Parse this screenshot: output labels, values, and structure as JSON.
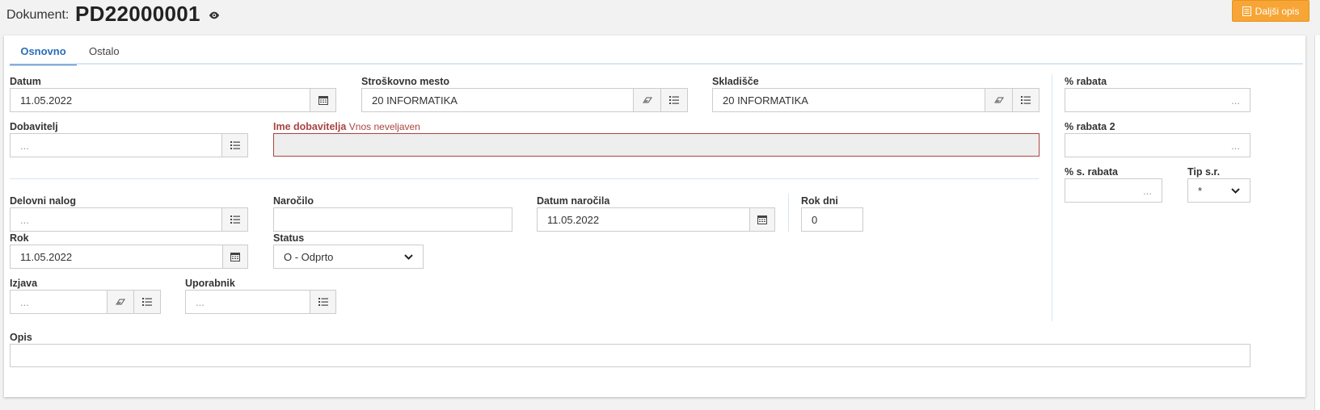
{
  "header": {
    "doc_label": "Dokument:",
    "doc_number": "PD22000001",
    "more_button": "Daljši opis"
  },
  "tabs": [
    {
      "label": "Osnovno",
      "active": true
    },
    {
      "label": "Ostalo",
      "active": false
    }
  ],
  "fields": {
    "datum": {
      "label": "Datum",
      "value": "11.05.2022"
    },
    "strosek": {
      "label": "Stroškovno mesto",
      "value": "20 INFORMATIKA"
    },
    "skladisce": {
      "label": "Skladišče",
      "value": "20 INFORMATIKA"
    },
    "rabat1": {
      "label": "% rabata",
      "placeholder": "..."
    },
    "dobavitelj": {
      "label": "Dobavitelj",
      "placeholder": "..."
    },
    "ime_dobavitelja": {
      "label": "Ime dobavitelja",
      "error": "Vnos neveljaven",
      "value": ""
    },
    "rabat2": {
      "label": "% rabata 2",
      "placeholder": "..."
    },
    "s_rabat": {
      "label": "% s. rabata",
      "placeholder": "..."
    },
    "tip_sr": {
      "label": "Tip s.r.",
      "value": "*"
    },
    "delovni_nalog": {
      "label": "Delovni nalog",
      "placeholder": "..."
    },
    "narocilo": {
      "label": "Naročilo",
      "value": ""
    },
    "datum_narocila": {
      "label": "Datum naročila",
      "value": "11.05.2022"
    },
    "rok_dni": {
      "label": "Rok dni",
      "value": "0"
    },
    "rok": {
      "label": "Rok",
      "value": "11.05.2022"
    },
    "status": {
      "label": "Status",
      "value": "O - Odprto"
    },
    "izjava": {
      "label": "Izjava",
      "placeholder": "..."
    },
    "uporabnik": {
      "label": "Uporabnik",
      "placeholder": "..."
    },
    "opis": {
      "label": "Opis",
      "value": ""
    }
  },
  "colors": {
    "accent": "#2a6eb7",
    "button": "#f7a536",
    "error": "#a94442"
  }
}
